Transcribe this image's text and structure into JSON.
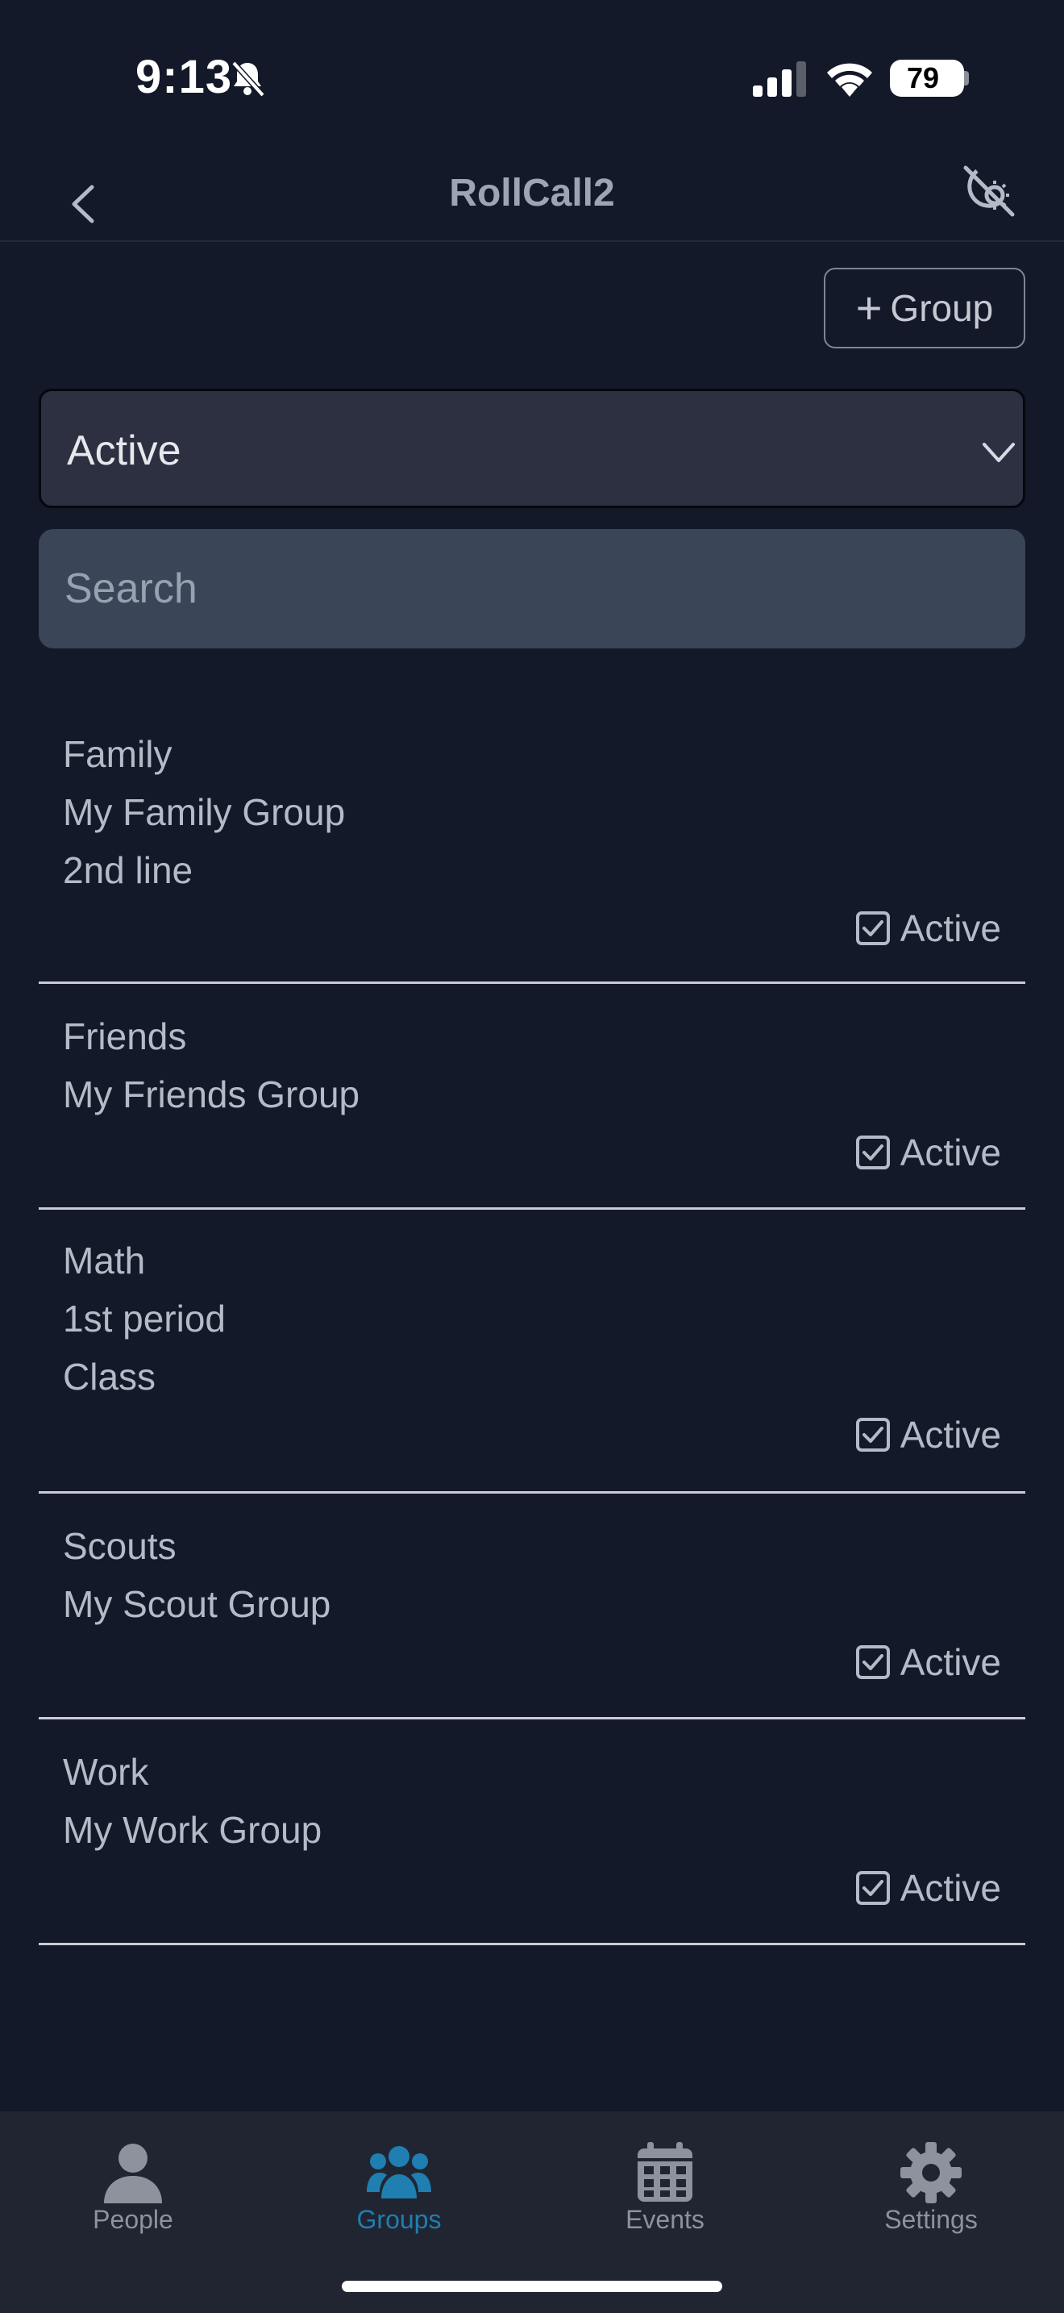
{
  "status_bar": {
    "time": "9:13",
    "battery": "79"
  },
  "nav": {
    "title": "RollCall2"
  },
  "toolbar": {
    "add_group_label": "Group"
  },
  "filter": {
    "selected": "Active"
  },
  "search": {
    "placeholder": "Search",
    "value": ""
  },
  "groups": [
    {
      "name": "Family",
      "description": "My Family Group",
      "extra": "2nd line",
      "status": "Active",
      "checked": true
    },
    {
      "name": "Friends",
      "description": "My Friends Group",
      "status": "Active",
      "checked": true
    },
    {
      "name": "Math",
      "description": "1st period",
      "extra": "Class",
      "status": "Active",
      "checked": true
    },
    {
      "name": "Scouts",
      "description": "My Scout Group",
      "status": "Active",
      "checked": true
    },
    {
      "name": "Work",
      "description": "My Work Group",
      "status": "Active",
      "checked": true
    }
  ],
  "tabs": [
    {
      "label": "People",
      "icon": "person-icon",
      "active": false
    },
    {
      "label": "Groups",
      "icon": "people-group-icon",
      "active": true
    },
    {
      "label": "Events",
      "icon": "calendar-icon",
      "active": false
    },
    {
      "label": "Settings",
      "icon": "gear-icon",
      "active": false
    }
  ],
  "colors": {
    "background": "#131929",
    "accent": "#1e7fb0",
    "tab_bar": "#212532"
  }
}
